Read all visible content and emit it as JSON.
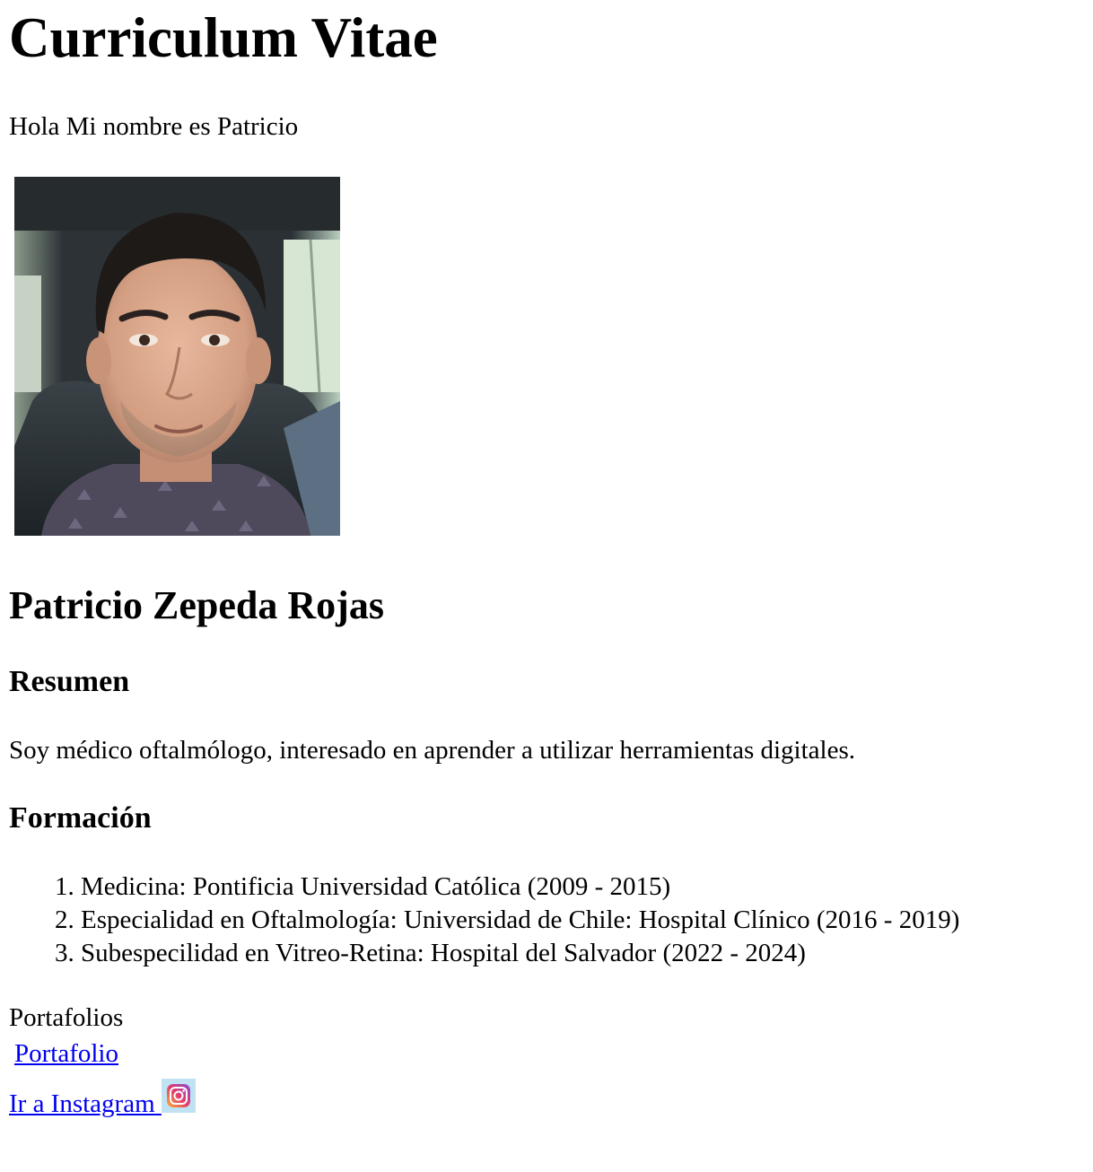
{
  "page": {
    "title": "Curriculum Vitae",
    "intro": "Hola Mi nombre es Patricio"
  },
  "profile": {
    "photo_icon": "profile-photo",
    "name": "Patricio Zepeda Rojas"
  },
  "resumen": {
    "heading": "Resumen",
    "text": "Soy médico oftalmólogo, interesado en aprender a utilizar herramientas digitales."
  },
  "formacion": {
    "heading": "Formación",
    "items": [
      "Medicina: Pontificia Universidad Católica (2009 - 2015)",
      "Especialidad en Oftalmología: Universidad de Chile: Hospital Clínico (2016 - 2019)",
      "Subespecilidad en Vitreo-Retina: Hospital del Salvador (2022 - 2024)"
    ]
  },
  "portafolios": {
    "label": "Portafolios",
    "link_text": "Portafolio"
  },
  "instagram": {
    "link_text": "Ir a Instagram",
    "icon": "instagram-icon"
  },
  "colors": {
    "link": "#0000ee",
    "text": "#000000",
    "background": "#ffffff"
  }
}
